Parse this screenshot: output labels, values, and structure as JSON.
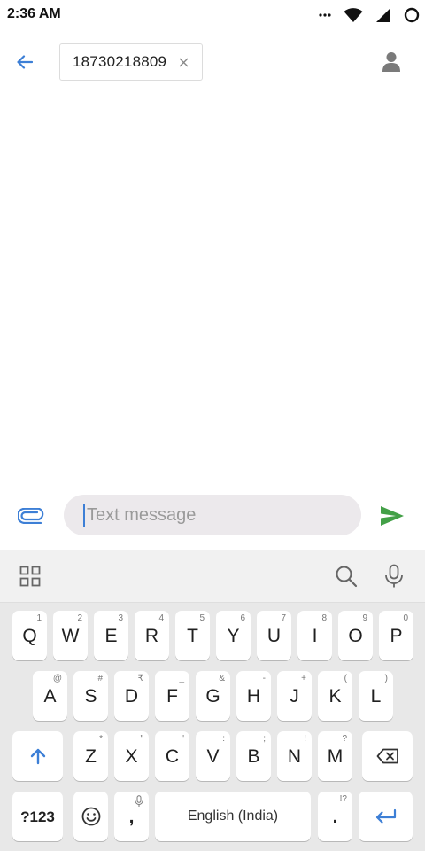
{
  "status_bar": {
    "time": "2:36 AM",
    "icons": [
      "more-dots-icon",
      "wifi-icon",
      "cell-signal-icon",
      "circle-status-icon"
    ]
  },
  "header": {
    "back_icon": "arrow-left-icon",
    "recipient_number": "18730218809",
    "chip_close_icon": "close-icon",
    "contact_icon": "person-icon"
  },
  "compose": {
    "attach_icon": "paperclip-icon",
    "placeholder": "Text message",
    "send_icon": "send-icon"
  },
  "keyboard": {
    "toolbar_icons": [
      "apps-grid-icon",
      "search-icon",
      "mic-icon"
    ],
    "row1": [
      {
        "label": "Q",
        "hint": "1"
      },
      {
        "label": "W",
        "hint": "2"
      },
      {
        "label": "E",
        "hint": "3"
      },
      {
        "label": "R",
        "hint": "4"
      },
      {
        "label": "T",
        "hint": "5"
      },
      {
        "label": "Y",
        "hint": "6"
      },
      {
        "label": "U",
        "hint": "7"
      },
      {
        "label": "I",
        "hint": "8"
      },
      {
        "label": "O",
        "hint": "9"
      },
      {
        "label": "P",
        "hint": "0"
      }
    ],
    "row2": [
      {
        "label": "A",
        "hint": "@"
      },
      {
        "label": "S",
        "hint": "#"
      },
      {
        "label": "D",
        "hint": "₹"
      },
      {
        "label": "F",
        "hint": "_"
      },
      {
        "label": "G",
        "hint": "&"
      },
      {
        "label": "H",
        "hint": "-"
      },
      {
        "label": "J",
        "hint": "+"
      },
      {
        "label": "K",
        "hint": "("
      },
      {
        "label": "L",
        "hint": ")"
      }
    ],
    "row3": [
      {
        "label": "Z",
        "hint": "*"
      },
      {
        "label": "X",
        "hint": "\""
      },
      {
        "label": "C",
        "hint": "'"
      },
      {
        "label": "V",
        "hint": ":"
      },
      {
        "label": "B",
        "hint": ";"
      },
      {
        "label": "N",
        "hint": "!"
      },
      {
        "label": "M",
        "hint": "?"
      }
    ],
    "shift_icon": "shift-arrow-icon",
    "backspace_icon": "backspace-icon",
    "symbols_label": "?123",
    "emoji_icon": "emoji-icon",
    "comma_label": ",",
    "space_label": "English (India)",
    "period_label": ".",
    "period_hint": "!?",
    "enter_icon": "enter-icon"
  },
  "colors": {
    "accent_blue": "#3d7fd6",
    "send_green": "#43a047",
    "message_box_bg": "#ece9ec",
    "keyboard_bg": "#e8e8e8"
  }
}
